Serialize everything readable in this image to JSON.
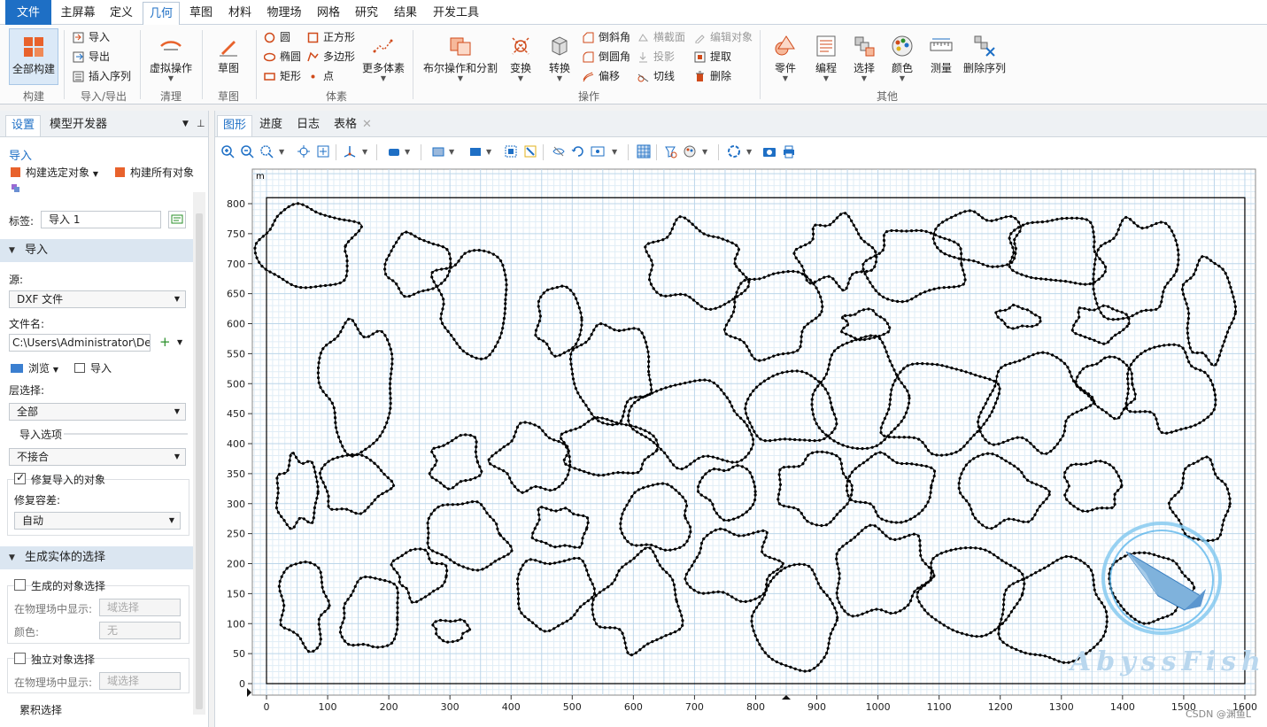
{
  "menubar": {
    "items": [
      "文件",
      "主屏幕",
      "定义",
      "几何",
      "草图",
      "材料",
      "物理场",
      "网格",
      "研究",
      "结果",
      "开发工具"
    ],
    "active": "几何"
  },
  "ribbon": {
    "build_all": "全部构建",
    "import": "导入",
    "export": "导出",
    "insert_sequence": "插入序列",
    "virtual_ops": "虚拟操作",
    "sketch": "草图",
    "circle": "圆",
    "ellipse": "椭圆",
    "rectangle": "矩形",
    "square": "正方形",
    "polygon": "多边形",
    "point": "点",
    "more_primitives": "更多体素",
    "boolean_partition": "布尔操作和分割",
    "transform": "变换",
    "convert": "转换",
    "chamfer": "倒斜角",
    "fillet": "倒圆角",
    "offset": "偏移",
    "cross_section": "横截面",
    "projection": "投影",
    "tangent": "切线",
    "edit_object": "编辑对象",
    "extract": "提取",
    "delete": "删除",
    "parts": "零件",
    "programming": "编程",
    "selections": "选择",
    "colors": "颜色",
    "measure": "测量",
    "delete_sequence": "删除序列",
    "groups": {
      "build": "构建",
      "import_export": "导入/导出",
      "cleanup": "清理",
      "sketch": "草图",
      "primitives": "体素",
      "operations": "操作",
      "other": "其他"
    }
  },
  "left_panel": {
    "tabs": [
      "设置",
      "模型开发器"
    ],
    "node_title": "导入",
    "build_selected": "构建选定对象",
    "build_all_objects": "构建所有对象",
    "label_caption": "标签:",
    "label_value": "导入 1",
    "section_import": "导入",
    "source_caption": "源:",
    "source_value": "DXF 文件",
    "filename_caption": "文件名:",
    "filename_value": "C:\\Users\\Administrator\\Des",
    "browse": "浏览",
    "import_btn": "导入",
    "layer_caption": "层选择:",
    "layer_value": "全部",
    "import_options_caption": "导入选项",
    "import_options_value": "不接合",
    "repair_label": "修复导入的对象",
    "repair_checked": true,
    "repair_tol_caption": "修复容差:",
    "repair_tol_value": "自动",
    "section_selections": "生成实体的选择",
    "gen_sel_label": "生成的对象选择",
    "show_in_physics_caption": "在物理场中显示:",
    "show_in_physics_value": "域选择",
    "color_caption": "颜色:",
    "color_value": "无",
    "indep_sel_label": "独立对象选择",
    "show_in_physics_value2": "域选择",
    "cumulative_sel_caption": "累积选择"
  },
  "graphics": {
    "tabs": [
      "图形",
      "进度",
      "日志",
      "表格"
    ],
    "active_tab": "图形",
    "axis_unit": "m",
    "x_ticks": [
      "0",
      "100",
      "200",
      "300",
      "400",
      "500",
      "600",
      "700",
      "800",
      "900",
      "1000",
      "1100",
      "1200",
      "1300",
      "1400",
      "1500",
      "1600"
    ],
    "y_ticks": [
      "0",
      "50",
      "100",
      "150",
      "200",
      "250",
      "300",
      "350",
      "400",
      "450",
      "500",
      "550",
      "600",
      "650",
      "700",
      "750",
      "800"
    ],
    "watermark": "AbyssFish",
    "credit": "CSDN @渊鱼L"
  },
  "colors": {
    "accent": "#1e6fc5",
    "grid_minor": "#e0edf6",
    "grid_major": "#bcd6ea",
    "geometry": "#000000"
  }
}
